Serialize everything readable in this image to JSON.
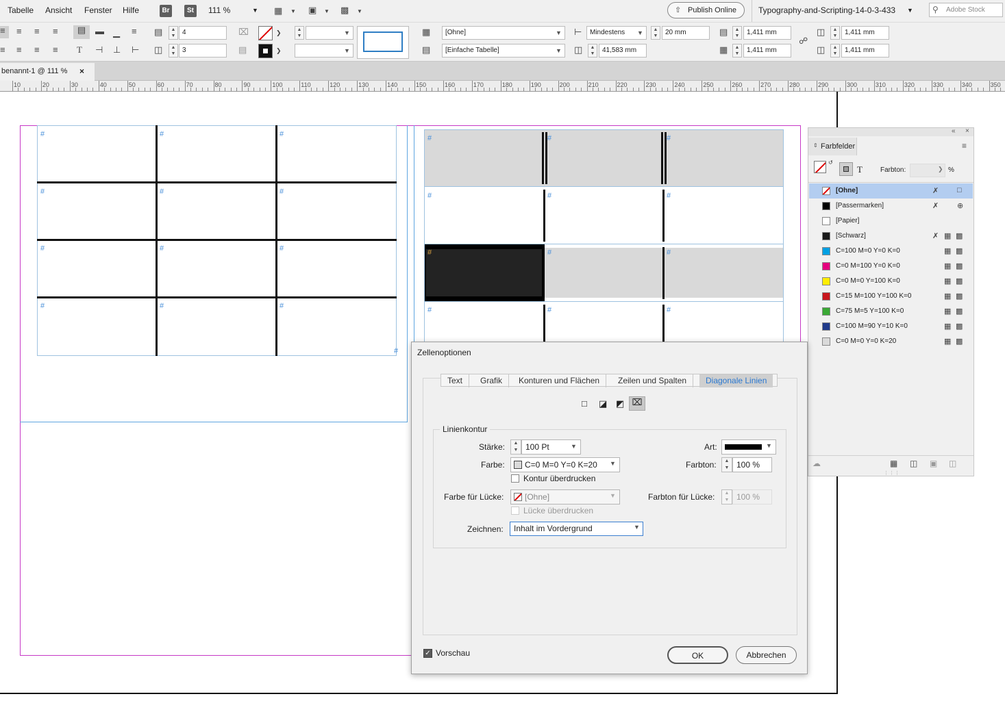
{
  "menubar": {
    "items": [
      "Tabelle",
      "Ansicht",
      "Fenster",
      "Hilfe"
    ],
    "bridge_badge": "Br",
    "stock_badge": "St",
    "zoom": "111 %",
    "publish_online": "Publish Online",
    "workspace": "Typography-and-Scripting-14-0-3-433",
    "search_placeholder": "Adobe Stock"
  },
  "control": {
    "rows_value": "4",
    "cols_value": "3",
    "cell_style": "[Ohne]",
    "table_style": "[Einfache Tabelle]",
    "row_height_mode": "Mindestens",
    "row_height": "20 mm",
    "col_width": "41,583 mm",
    "inset_top": "1,411 mm",
    "inset_bottom": "1,411 mm",
    "inset_left": "1,411 mm",
    "inset_right": "1,411 mm"
  },
  "document": {
    "tab_title": "benannt-1 @ 111 %",
    "ruler_labels": [
      "10",
      "20",
      "30",
      "40",
      "50",
      "60",
      "70",
      "80",
      "90",
      "100",
      "110",
      "120",
      "130",
      "140",
      "150",
      "160",
      "170",
      "180",
      "190",
      "200",
      "210",
      "220",
      "230",
      "240",
      "250",
      "260",
      "270",
      "280",
      "290",
      "300",
      "310",
      "320",
      "330",
      "340",
      "350"
    ]
  },
  "swatches_panel": {
    "title": "Farbfelder",
    "tint_label": "Farbton:",
    "tint_unit": "%",
    "items": [
      {
        "name": "[Ohne]",
        "color": "none",
        "selected": true
      },
      {
        "name": "[Passermarken]",
        "color": "#000000"
      },
      {
        "name": "[Papier]",
        "color": "#ffffff"
      },
      {
        "name": "[Schwarz]",
        "color": "#1a1a1a"
      },
      {
        "name": "C=100 M=0 Y=0 K=0",
        "color": "#00a0e3"
      },
      {
        "name": "C=0 M=100 Y=0 K=0",
        "color": "#e5007e"
      },
      {
        "name": "C=0 M=0 Y=100 K=0",
        "color": "#ffed00"
      },
      {
        "name": "C=15 M=100 Y=100 K=0",
        "color": "#c8161d"
      },
      {
        "name": "C=75 M=5 Y=100 K=0",
        "color": "#3aa935"
      },
      {
        "name": "C=100 M=90 Y=10 K=0",
        "color": "#1f3a8a"
      },
      {
        "name": "C=0 M=0 Y=0 K=20",
        "color": "#dadada"
      }
    ]
  },
  "dialog": {
    "title": "Zellenoptionen",
    "tabs": [
      "Text",
      "Grafik",
      "Konturen und Flächen",
      "Zeilen und Spalten",
      "Diagonale Linien"
    ],
    "active_tab": "Diagonale Linien",
    "group_title": "Linienkontur",
    "staerke_label": "Stärke:",
    "staerke_value": "100 Pt",
    "art_label": "Art:",
    "farbe_label": "Farbe:",
    "farbe_value": "C=0 M=0 Y=0 K=20",
    "farbton_label": "Farbton:",
    "farbton_value": "100 %",
    "kontur_ueberdrucken": "Kontur überdrucken",
    "luecke_label": "Farbe für Lücke:",
    "luecke_value": "[Ohne]",
    "luecke_farbton_label": "Farbton für Lücke:",
    "luecke_farbton_value": "100 %",
    "luecke_ueberdrucken": "Lücke überdrucken",
    "zeichnen_label": "Zeichnen:",
    "zeichnen_value": "Inhalt im Vordergrund",
    "vorschau": "Vorschau",
    "ok": "OK",
    "abbrechen": "Abbrechen"
  }
}
